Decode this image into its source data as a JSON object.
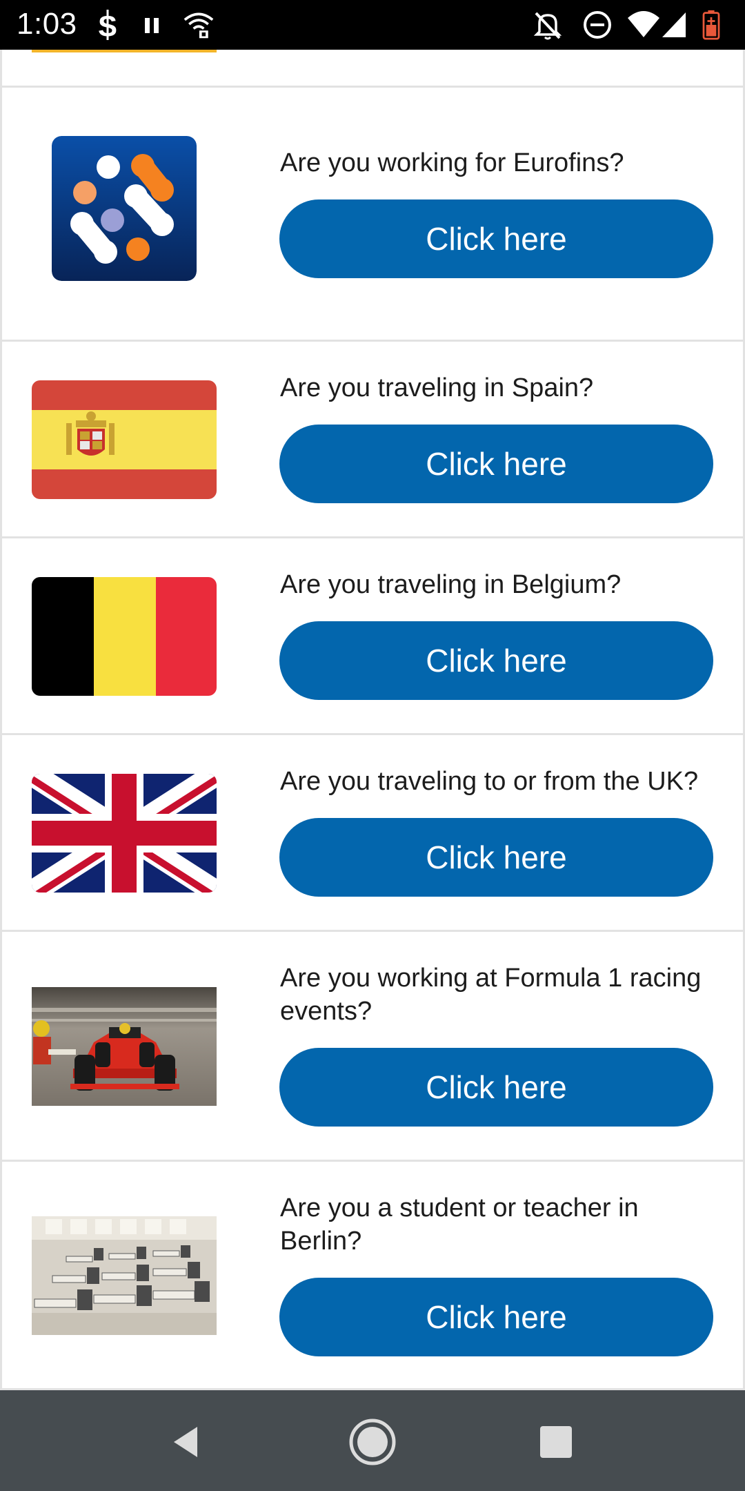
{
  "status_bar": {
    "time": "1:03",
    "icons": [
      "s-app-icon",
      "pause-icon",
      "wifi-lock-icon",
      "notifications-off-icon",
      "do-not-disturb-icon",
      "wifi-icon",
      "cell-signal-icon",
      "battery-charging-icon"
    ],
    "battery_color": "#e8583a"
  },
  "cards": [
    {
      "image": "eurofins-logo",
      "question": "Are you working for Eurofins?",
      "button_label": "Click here"
    },
    {
      "image": "spain-flag",
      "question": "Are you traveling in Spain?",
      "button_label": "Click here"
    },
    {
      "image": "belgium-flag",
      "question": "Are you traveling in Belgium?",
      "button_label": "Click here"
    },
    {
      "image": "uk-flag",
      "question": "Are you traveling to or from the UK?",
      "button_label": "Click here"
    },
    {
      "image": "formula1-car-photo",
      "question": "Are you working at Formula 1 racing events?",
      "button_label": "Click here"
    },
    {
      "image": "classroom-photo",
      "question": "Are you a student or teacher in Berlin?",
      "button_label": "Click here"
    }
  ],
  "colors": {
    "button": "#0366ad",
    "button_text": "#ffffff",
    "divider": "#e2e2e2",
    "nav_bar": "#464c50"
  },
  "nav_bar": {
    "buttons": [
      "back-icon",
      "home-icon",
      "recents-icon"
    ]
  }
}
